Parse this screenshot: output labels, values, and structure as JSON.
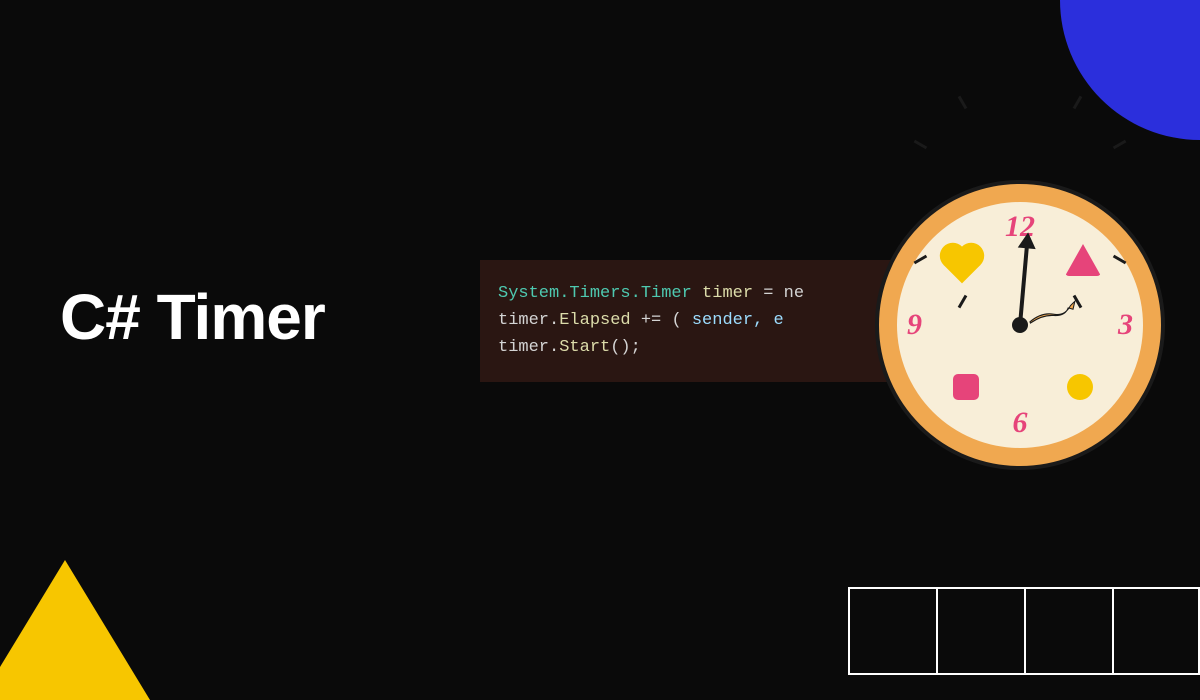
{
  "title": "C# Timer",
  "code": {
    "line1": {
      "namespace": "System.Timers.Timer",
      "var": "timer",
      "op": " = ",
      "tail": "ne"
    },
    "line2": {
      "prefix": "timer.",
      "member": "Elapsed",
      "op": " += ( ",
      "params": "sender, e"
    },
    "line3": {
      "prefix": "timer.",
      "method": "Start",
      "tail": "();"
    }
  },
  "clock": {
    "n12": "12",
    "n3": "3",
    "n6": "6",
    "n9": "9"
  },
  "colors": {
    "bg": "#0a0a0a",
    "blue": "#2b2fdc",
    "yellow": "#f7c600",
    "pink": "#e6447a",
    "clockRim": "#f0a850",
    "clockFace": "#f8eed8",
    "codeBg": "#2a1612"
  }
}
